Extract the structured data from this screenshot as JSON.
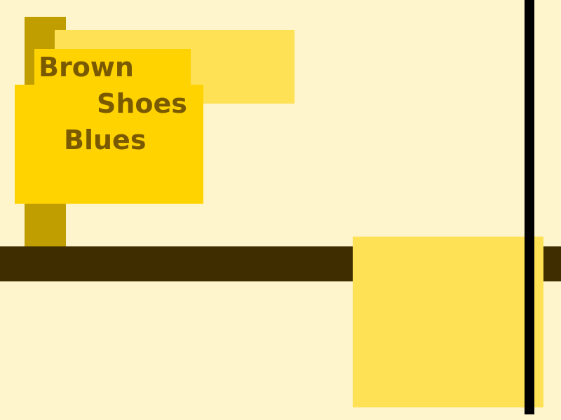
{
  "title_lines": [
    "Brown",
    "Shoes",
    "Blues"
  ],
  "colors": {
    "background": "#FFF5CC",
    "dark_brown_bar": "#3F2D00",
    "olive_gold": "#C09E00",
    "golden_yellow": "#FFD300",
    "light_yellow": "#FFE155",
    "black_line": "#000000",
    "text": "#7A5A00"
  }
}
